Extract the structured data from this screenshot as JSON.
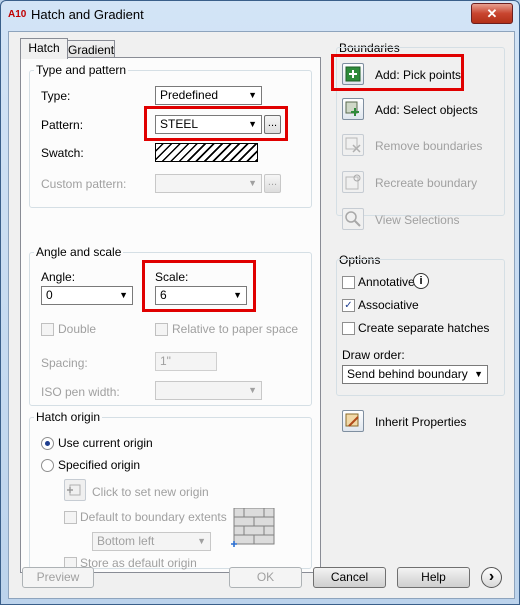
{
  "window": {
    "title": "Hatch and Gradient",
    "app_icon_text": "A10",
    "close_glyph": "✕"
  },
  "tabs": [
    {
      "label": "Hatch"
    },
    {
      "label": "Gradient"
    }
  ],
  "type_pattern": {
    "title": "Type and pattern",
    "type_label": "Type:",
    "type_value": "Predefined",
    "pattern_label": "Pattern:",
    "pattern_value": "STEEL",
    "swatch_label": "Swatch:",
    "custom_label": "Custom pattern:",
    "custom_value": "",
    "ellipsis": "..."
  },
  "angle_scale": {
    "title": "Angle and scale",
    "angle_label": "Angle:",
    "angle_value": "0",
    "scale_label": "Scale:",
    "scale_value": "6",
    "double_label": "Double",
    "relative_label": "Relative to paper space",
    "spacing_label": "Spacing:",
    "spacing_value": "1\"",
    "iso_label": "ISO pen width:",
    "iso_value": ""
  },
  "hatch_origin": {
    "title": "Hatch origin",
    "use_current": "Use current origin",
    "specified": "Specified origin",
    "click_set": "Click to set new origin",
    "default_extents": "Default to boundary extents",
    "position_value": "Bottom left",
    "store_default": "Store as default origin"
  },
  "boundaries": {
    "title": "Boundaries",
    "add_pick": "Add: Pick points",
    "add_select": "Add: Select objects",
    "remove": "Remove boundaries",
    "recreate": "Recreate boundary",
    "view": "View Selections"
  },
  "options": {
    "title": "Options",
    "annotative": "Annotative",
    "info_glyph": "i",
    "associative": "Associative",
    "associative_checked": true,
    "separate": "Create separate hatches",
    "draw_order_label": "Draw order:",
    "draw_order_value": "Send behind boundary"
  },
  "inherit": "Inherit Properties",
  "buttons": {
    "preview": "Preview",
    "ok": "OK",
    "cancel": "Cancel",
    "help": "Help",
    "more_glyph": "›"
  },
  "colors": {
    "highlight": "#e00000"
  }
}
